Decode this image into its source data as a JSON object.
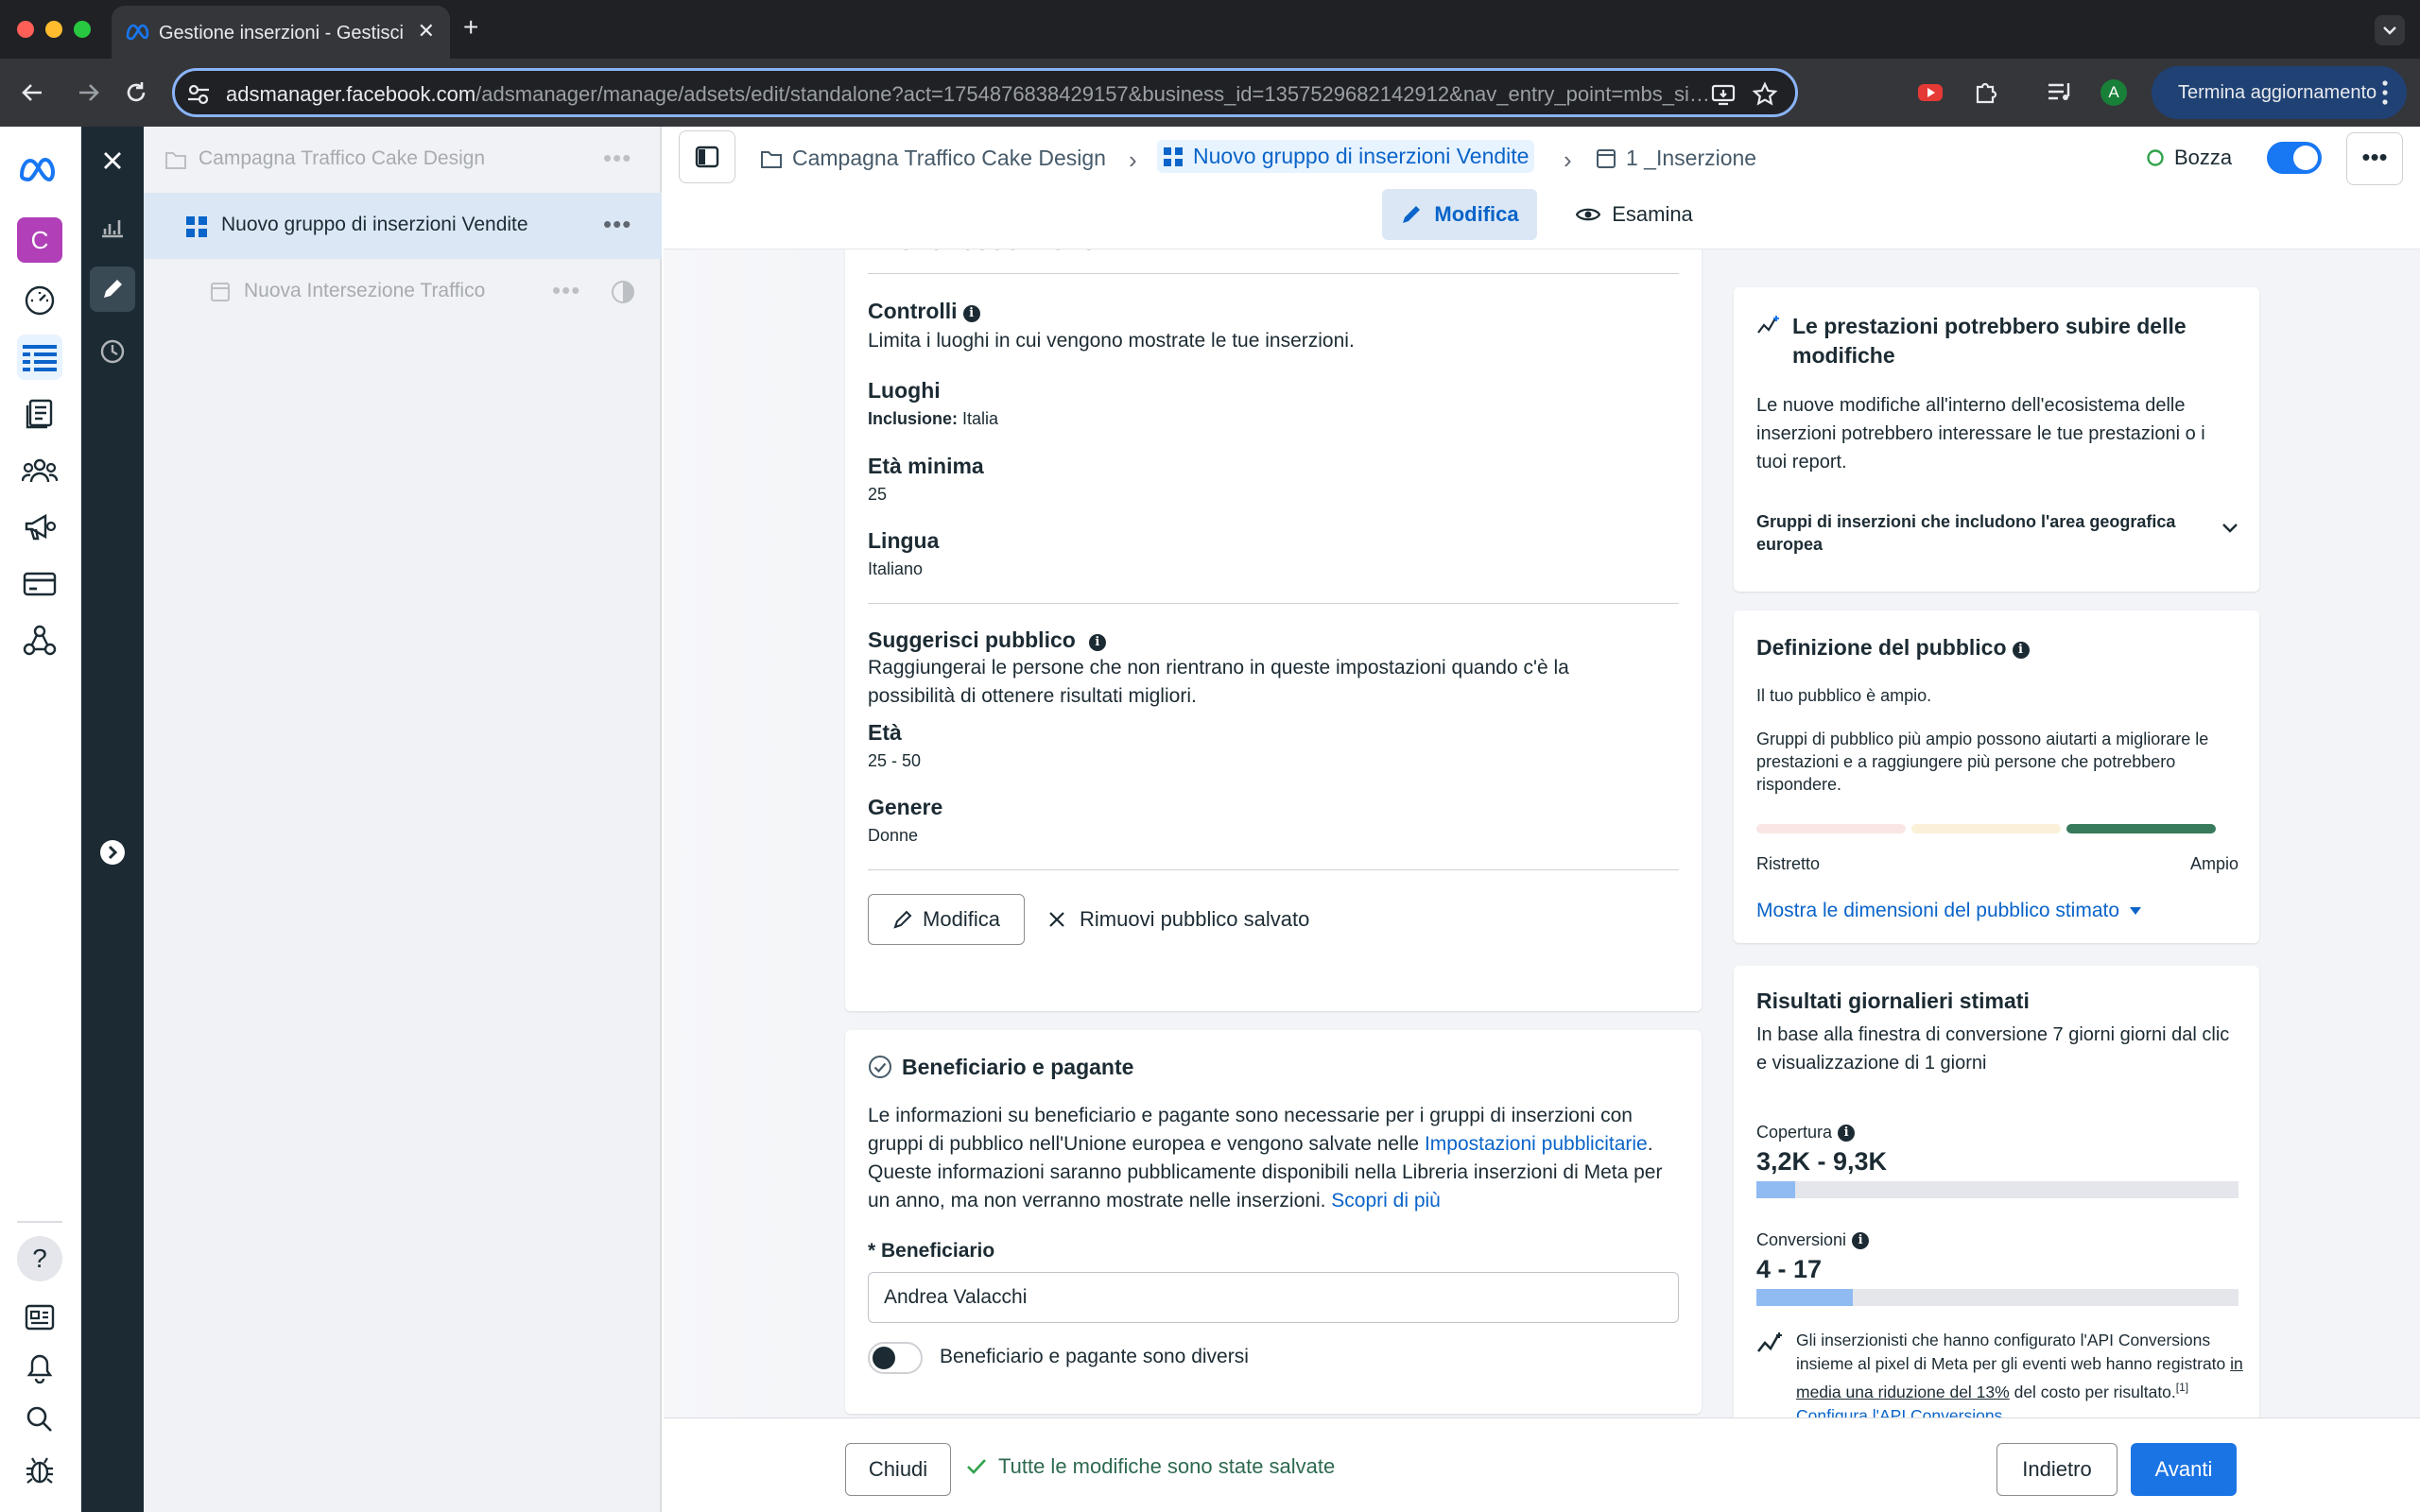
{
  "browser": {
    "tab_title": "Gestione inserzioni - Gestisci",
    "url_domain": "adsmanager.facebook.com",
    "url_path": "/adsmanager/manage/adsets/edit/standalone?act=1754876838429157&business_id=1357529682142912&nav_entry_point=mbs_side...",
    "profile_initial": "A",
    "update_label": "Termina aggiornamento"
  },
  "rail": {
    "account_initial": "C"
  },
  "tree": {
    "campaign": "Campagna Traffico Cake Design",
    "adset": "Nuovo gruppo di inserzioni Vendite",
    "ad": "Nuova Intersezione Traffico"
  },
  "header": {
    "crumb_campaign": "Campagna Traffico Cake Design",
    "crumb_adset": "Nuovo gruppo di inserzioni Vendite",
    "crumb_ad": "1 _Inserzione",
    "status": "Bozza",
    "tab_edit": "Modifica",
    "tab_review": "Esamina"
  },
  "audience": {
    "id_partial": "1754876838429157",
    "controls_title": "Controlli",
    "controls_desc": "Limita i luoghi in cui vengono mostrate le tue inserzioni.",
    "locations_label": "Luoghi",
    "locations_prefix": "Inclusione:",
    "locations_value": "Italia",
    "min_age_label": "Età minima",
    "min_age_value": "25",
    "language_label": "Lingua",
    "language_value": "Italiano",
    "suggest_title": "Suggerisci pubblico",
    "suggest_desc": "Raggiungerai le persone che non rientrano in queste impostazioni quando c'è la possibilità di ottenere risultati migliori.",
    "age_label": "Età",
    "age_value": "25 - 50",
    "gender_label": "Genere",
    "gender_value": "Donne",
    "edit_button": "Modifica",
    "remove_button": "Rimuovi pubblico salvato"
  },
  "beneficiary": {
    "title": "Beneficiario e pagante",
    "desc_1": "Le informazioni su beneficiario e pagante sono necessarie per i gruppi di inserzioni con gruppi di pubblico nell'Unione europea e vengono salvate nelle ",
    "desc_link": "Impostazioni pubblicitarie",
    "desc_2": ". Queste informazioni saranno pubblicamente disponibili nella Libreria inserzioni di Meta per un anno, ma non verranno mostrate nelle inserzioni. ",
    "desc_link2": "Scopri di più",
    "field_label": "* Beneficiario",
    "field_value": "Andrea Valacchi",
    "toggle_label": "Beneficiario e pagante sono diversi"
  },
  "perf_card": {
    "title": "Le prestazioni potrebbero subire delle modifiche",
    "desc": "Le nuove modifiche all'interno dell'ecosistema delle inserzioni potrebbero interessare le tue prestazioni o i tuoi report.",
    "accordion": "Gruppi di inserzioni che includono l'area geografica europea"
  },
  "definition_card": {
    "title": "Definizione del pubblico",
    "line1": "Il tuo pubblico è ampio.",
    "line2": "Gruppi di pubblico più ampio possono aiutarti a migliorare le prestazioni e a raggiungere più persone che potrebbero rispondere.",
    "gauge_level": "Ampio",
    "gauge_min": "Ristretto",
    "gauge_max": "Ampio",
    "link": "Mostra le dimensioni del pubblico stimato"
  },
  "results_card": {
    "title": "Risultati giornalieri stimati",
    "desc": "In base alla finestra di conversione 7 giorni giorni dal clic e visualizzazione di 1 giorni",
    "reach_label": "Copertura",
    "reach_value": "3,2K - 9,3K",
    "reach_fill": 0.08,
    "conv_label": "Conversioni",
    "conv_value": "4 - 17",
    "conv_fill": 0.2,
    "note_1": "Gli inserzionisti che hanno configurato l'API Conversions insieme al pixel di Meta per gli eventi web hanno registrato ",
    "note_link": "in media una riduzione del 13%",
    "note_2": " del costo per risultato.",
    "note_sup": "[1]",
    "note_link2": "Configura l'API Conversions"
  },
  "footer": {
    "close": "Chiudi",
    "saved": "Tutte le modifiche sono state salvate",
    "back": "Indietro",
    "next": "Avanti"
  },
  "colors": {
    "accent": "#1877f2",
    "primary_button": "#1b74e4",
    "link": "#0a64c9",
    "rail_dark": "#1c2b33"
  }
}
